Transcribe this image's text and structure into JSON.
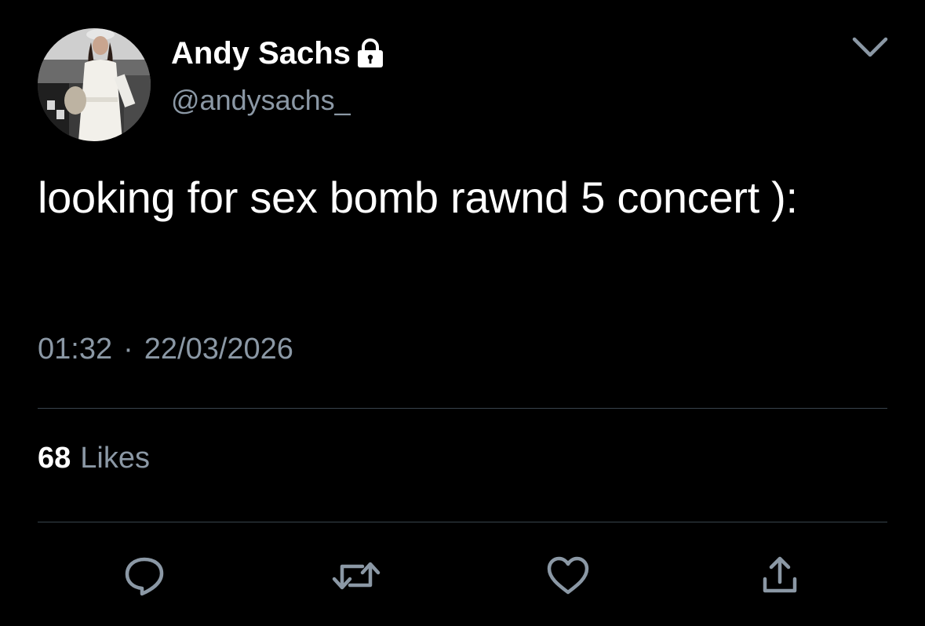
{
  "author": {
    "display_name": "Andy Sachs",
    "handle": "@andysachs_",
    "avatar_icon": "profile-photo",
    "protected_icon": "lock-icon"
  },
  "tweet": {
    "text": "looking for sex bomb rawnd 5 concert ):",
    "time": "01:32",
    "separator": "·",
    "date": "22/03/2026"
  },
  "stats": {
    "likes_count": "68",
    "likes_label": "Likes"
  },
  "actions": [
    "reply-icon",
    "retweet-icon",
    "like-icon",
    "share-icon"
  ],
  "colors": {
    "background": "#000000",
    "primary_text": "#ffffff",
    "secondary_text": "#8b98a5",
    "divider": "#38444d"
  }
}
